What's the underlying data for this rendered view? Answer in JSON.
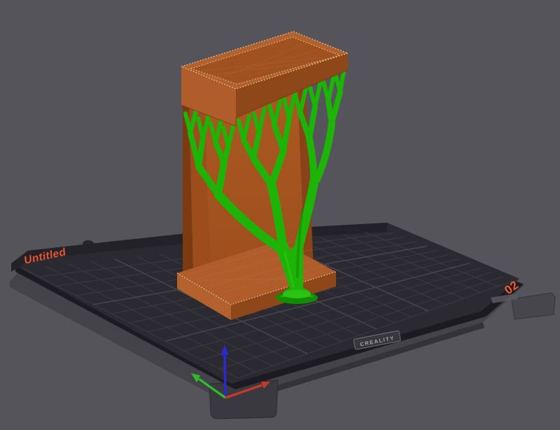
{
  "viewport": {
    "background_color": "#55545b"
  },
  "plate": {
    "name_label": "Untitled",
    "plate_number": "02",
    "brand": "CREALITY",
    "label_color": "#e8532e",
    "number_color": "#f05a2c",
    "surface_color": "#2b2a31",
    "grid_line_color": "#3b3a42",
    "grid_major_line_color": "#484750",
    "edge_lip_color": "#232229",
    "side_color": "#1c1b21",
    "platform_color": "#444349",
    "badge_fill": "#38373e",
    "badge_text_color": "#aaa9b0"
  },
  "model": {
    "frame_color": "#b05d2b",
    "frame_light_color": "#b4612e",
    "frame_dark_color": "#8e4719",
    "frame_darker_color": "#7c3a11",
    "rim_dash_color": "#ead9ac",
    "tree_color": "#1db307",
    "tree_dark_color": "#128c00",
    "tree_light_color": "#2cc414"
  },
  "axis_indicator": {
    "x_color": "#c33a2b",
    "y_color": "#2fb92f",
    "z_color": "#2a2ad0"
  }
}
